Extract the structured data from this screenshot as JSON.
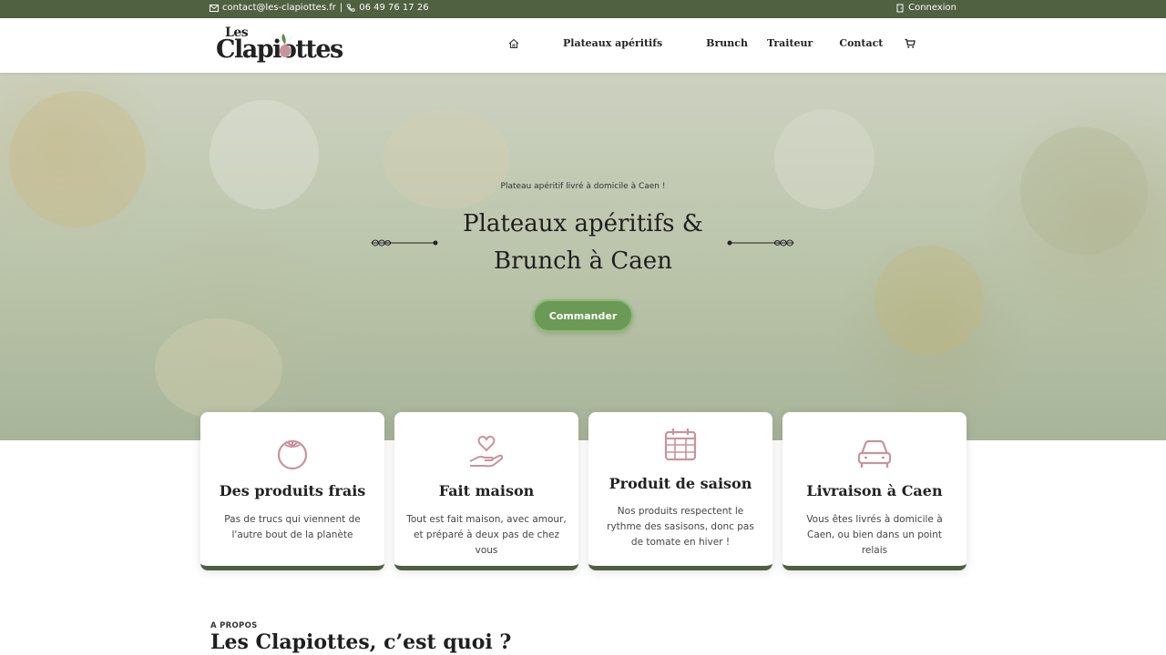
{
  "topbar": {
    "email": "contact@les-clapiottes.fr",
    "separator": "|",
    "phone": "06 49 76 17 26",
    "login": "Connexion"
  },
  "logo": {
    "les": "Les",
    "name": "Clapiottes"
  },
  "nav": {
    "items": [
      "Plateaux apéritifs",
      "Brunch",
      "Traiteur",
      "Contact"
    ]
  },
  "hero": {
    "subtitle": "Plateau apéritif livré à domicile à Caen !",
    "title": "Plateaux apéritifs & Brunch à Caen",
    "cta": "Commander"
  },
  "features": [
    {
      "icon": "tomato-icon",
      "title": "Des produits frais",
      "desc": "Pas de trucs qui viennent de l'autre bout de la planète"
    },
    {
      "icon": "heart-hand-icon",
      "title": "Fait maison",
      "desc": "Tout est fait maison, avec amour, et préparé à deux pas de chez vous"
    },
    {
      "icon": "calendar-icon",
      "title": "Produit de saison",
      "desc": "Nos produits respectent le rythme des sasisons, donc pas de tomate en hiver !"
    },
    {
      "icon": "car-icon",
      "title": "Livraison à Caen",
      "desc": "Vous êtes livrés à domicile à Caen, ou bien dans un point relais"
    }
  ],
  "about": {
    "kicker": "A PROPOS",
    "title": "Les Clapiottes, c’est quoi ?"
  },
  "colors": {
    "topbar": "#4f6140",
    "accent_green": "#6a9a55",
    "icon_pink": "#c9939d",
    "card_border": "#4f5e42"
  }
}
